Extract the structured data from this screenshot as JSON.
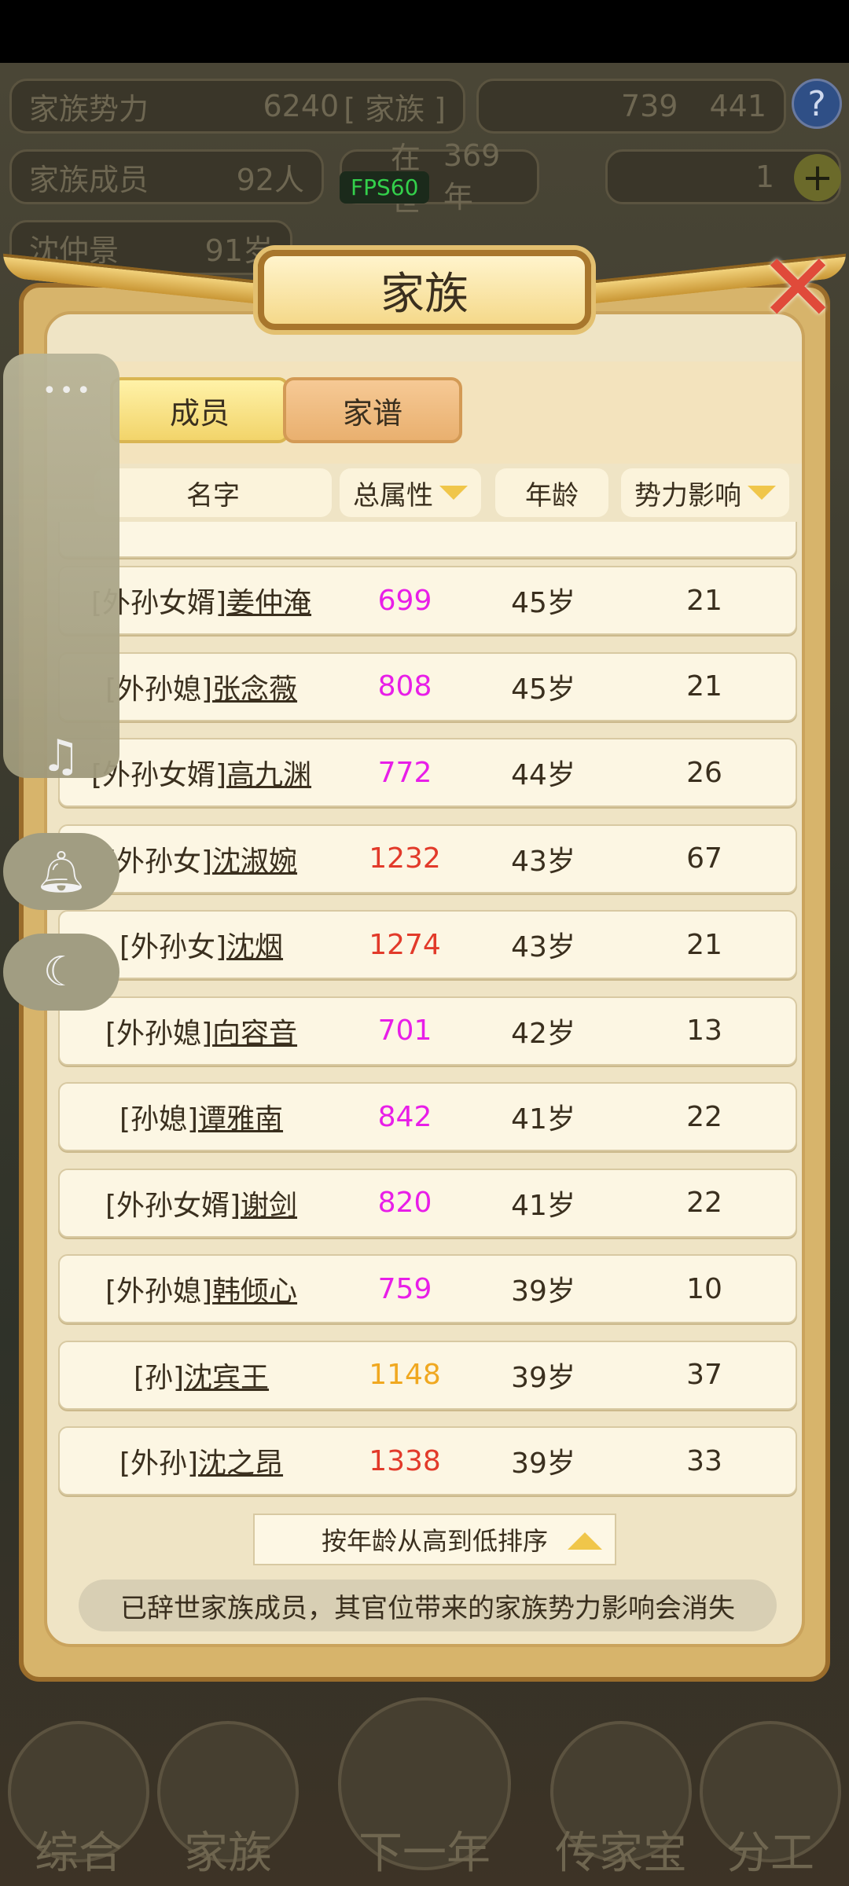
{
  "top_bar": {
    "power_label": "家族势力",
    "power_value": "6240",
    "power_rank": "[ 家族 ]",
    "currency_a": "739",
    "currency_b": "441",
    "members_label": "家族成员",
    "members_value": "92人",
    "era_label": "在世",
    "era_value": "369年",
    "gold_value": "1",
    "patriarch_name": "沈仲景",
    "patriarch_age": "91岁",
    "fps": "FPS60"
  },
  "panel": {
    "title": "家族",
    "tabs": [
      {
        "label": "成员"
      },
      {
        "label": "家谱"
      }
    ],
    "columns": {
      "name": "名字",
      "attr": "总属性",
      "age": "年龄",
      "influence": "势力影响"
    },
    "rows": [
      {
        "title": "[外孙女婿]",
        "name": "姜仲淹",
        "attr": "699",
        "age": "45岁",
        "influence": "21",
        "attr_color": "#e81ee8"
      },
      {
        "title": "[外孙媳]",
        "name": "张念薇",
        "attr": "808",
        "age": "45岁",
        "influence": "21",
        "attr_color": "#e81ee8"
      },
      {
        "title": "[外孙女婿]",
        "name": "高九渊",
        "attr": "772",
        "age": "44岁",
        "influence": "26",
        "attr_color": "#e81ee8"
      },
      {
        "title": "[外孙女]",
        "name": "沈淑婉",
        "attr": "1232",
        "age": "43岁",
        "influence": "67",
        "attr_color": "#e23a2a"
      },
      {
        "title": "[外孙女]",
        "name": "沈烟",
        "attr": "1274",
        "age": "43岁",
        "influence": "21",
        "attr_color": "#e23a2a"
      },
      {
        "title": "[外孙媳]",
        "name": "向容音",
        "attr": "701",
        "age": "42岁",
        "influence": "13",
        "attr_color": "#e81ee8"
      },
      {
        "title": "[孙媳]",
        "name": "谭雅南",
        "attr": "842",
        "age": "41岁",
        "influence": "22",
        "attr_color": "#e81ee8"
      },
      {
        "title": "[外孙女婿]",
        "name": "谢剑",
        "attr": "820",
        "age": "41岁",
        "influence": "22",
        "attr_color": "#e81ee8"
      },
      {
        "title": "[外孙媳]",
        "name": "韩倾心",
        "attr": "759",
        "age": "39岁",
        "influence": "10",
        "attr_color": "#e81ee8"
      },
      {
        "title": "[孙]",
        "name": "沈宾王",
        "attr": "1148",
        "age": "39岁",
        "influence": "37",
        "attr_color": "#f0a820"
      },
      {
        "title": "[外孙]",
        "name": "沈之昂",
        "attr": "1338",
        "age": "39岁",
        "influence": "33",
        "attr_color": "#e23a2a"
      }
    ],
    "sort_label": "按年龄从高到低排序",
    "notice": "已辞世家族成员，其官位带来的家族势力影响会消失"
  },
  "bottom_nav": [
    {
      "label": "综合"
    },
    {
      "label": "家族"
    },
    {
      "label": "下一年"
    },
    {
      "label": "传家宝"
    },
    {
      "label": "分工"
    }
  ]
}
